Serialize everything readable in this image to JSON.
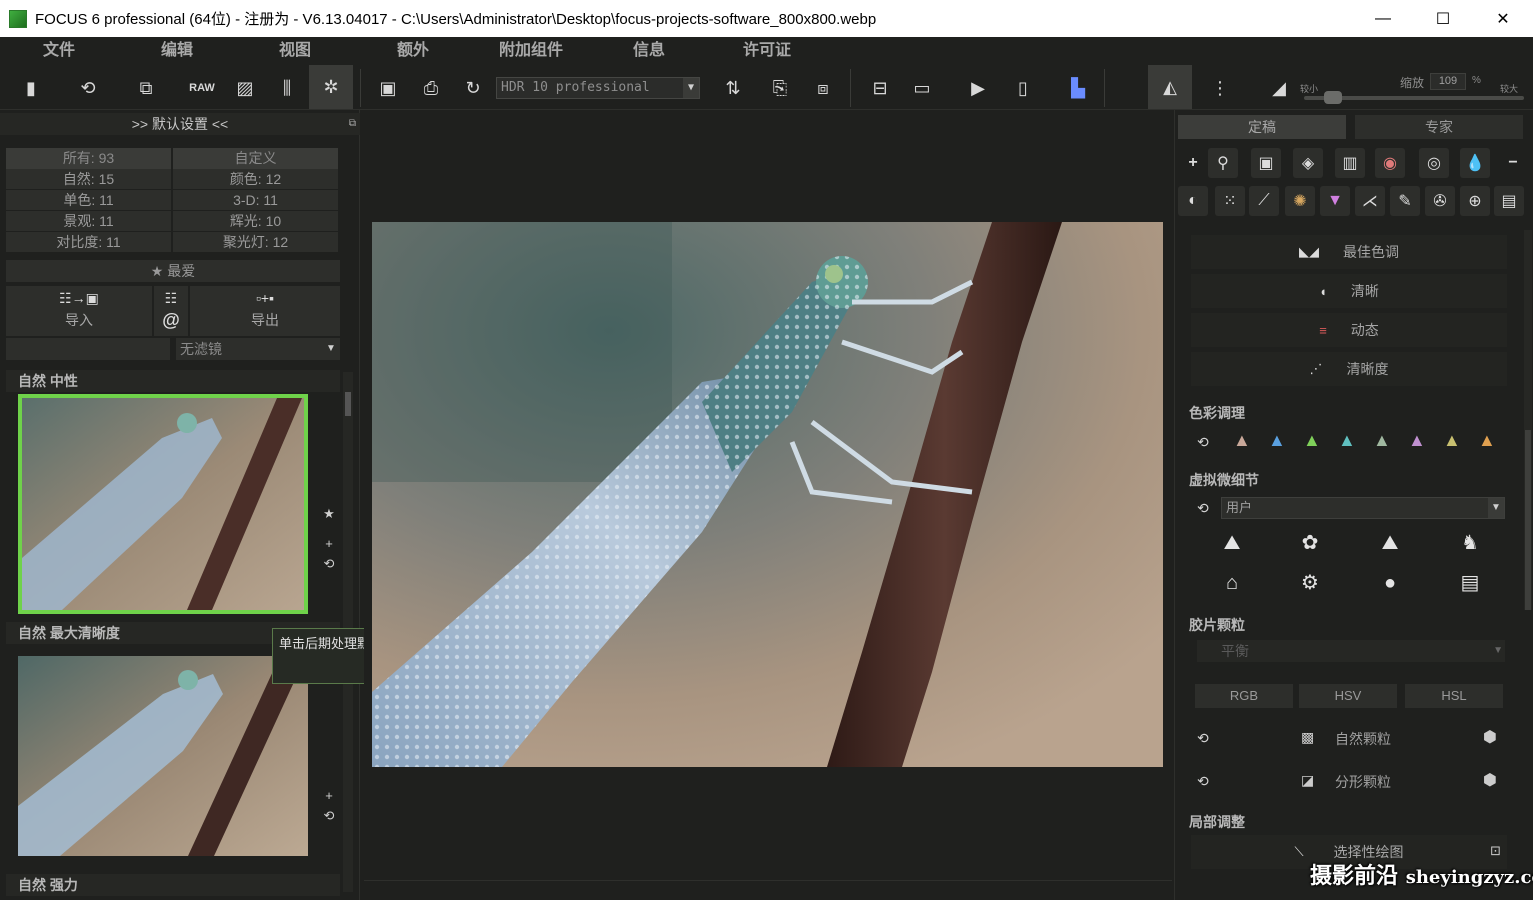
{
  "window": {
    "title": "FOCUS 6 professional (64位) - 注册为 - V6.13.04017 - C:\\Users\\Administrator\\Desktop\\focus-projects-software_800x800.webp",
    "min": "—",
    "max": "☐",
    "close": "✕"
  },
  "menu": [
    "文件",
    "编辑",
    "视图",
    "额外",
    "附加组件",
    "信息",
    "许可证"
  ],
  "toolbar": {
    "preset_value": "HDR 10 professional",
    "zoom_label": "缩放",
    "zoom_value": "109",
    "zoom_unit": "%",
    "zoom_min_label": "较小",
    "zoom_max_label": "较大",
    "zoom_level": 0.1
  },
  "left": {
    "header": ">> 默认设置 <<",
    "restore": "⧉",
    "categories": [
      [
        "所有: 93",
        "自定义"
      ],
      [
        "自然: 15",
        "颜色: 12"
      ],
      [
        "单色: 11",
        "3-D: 11"
      ],
      [
        "景观: 11",
        "辉光: 10"
      ],
      [
        "对比度: 11",
        "聚光灯: 12"
      ]
    ],
    "favorites": "★ 最爱",
    "import_label": "导入",
    "at_label": "@",
    "export_label": "导出",
    "filter_value": "无滤镜",
    "presets": [
      {
        "title": "自然 中性"
      },
      {
        "title": "自然 最大清晰度"
      },
      {
        "title": "自然 强力"
      }
    ]
  },
  "tooltip": "单击后期处理默认设置以激活它",
  "right": {
    "tabs": [
      "定稿",
      "专家"
    ],
    "tone_items": [
      "最佳色调",
      "清晰",
      "动态",
      "清晰度"
    ],
    "color_section": "色彩调理",
    "vmd_section": "虚拟微细节",
    "vmd_value": "用户",
    "grain_section": "胶片颗粒",
    "grain_value": "平衡",
    "modes": [
      "RGB",
      "HSV",
      "HSL"
    ],
    "grain_items": [
      "自然颗粒",
      "分形颗粒"
    ],
    "local_section": "局部调整",
    "local_item": "选择性绘图"
  },
  "watermark": {
    "text": "摄影前沿",
    "domain": "sheyingzyz.com"
  }
}
